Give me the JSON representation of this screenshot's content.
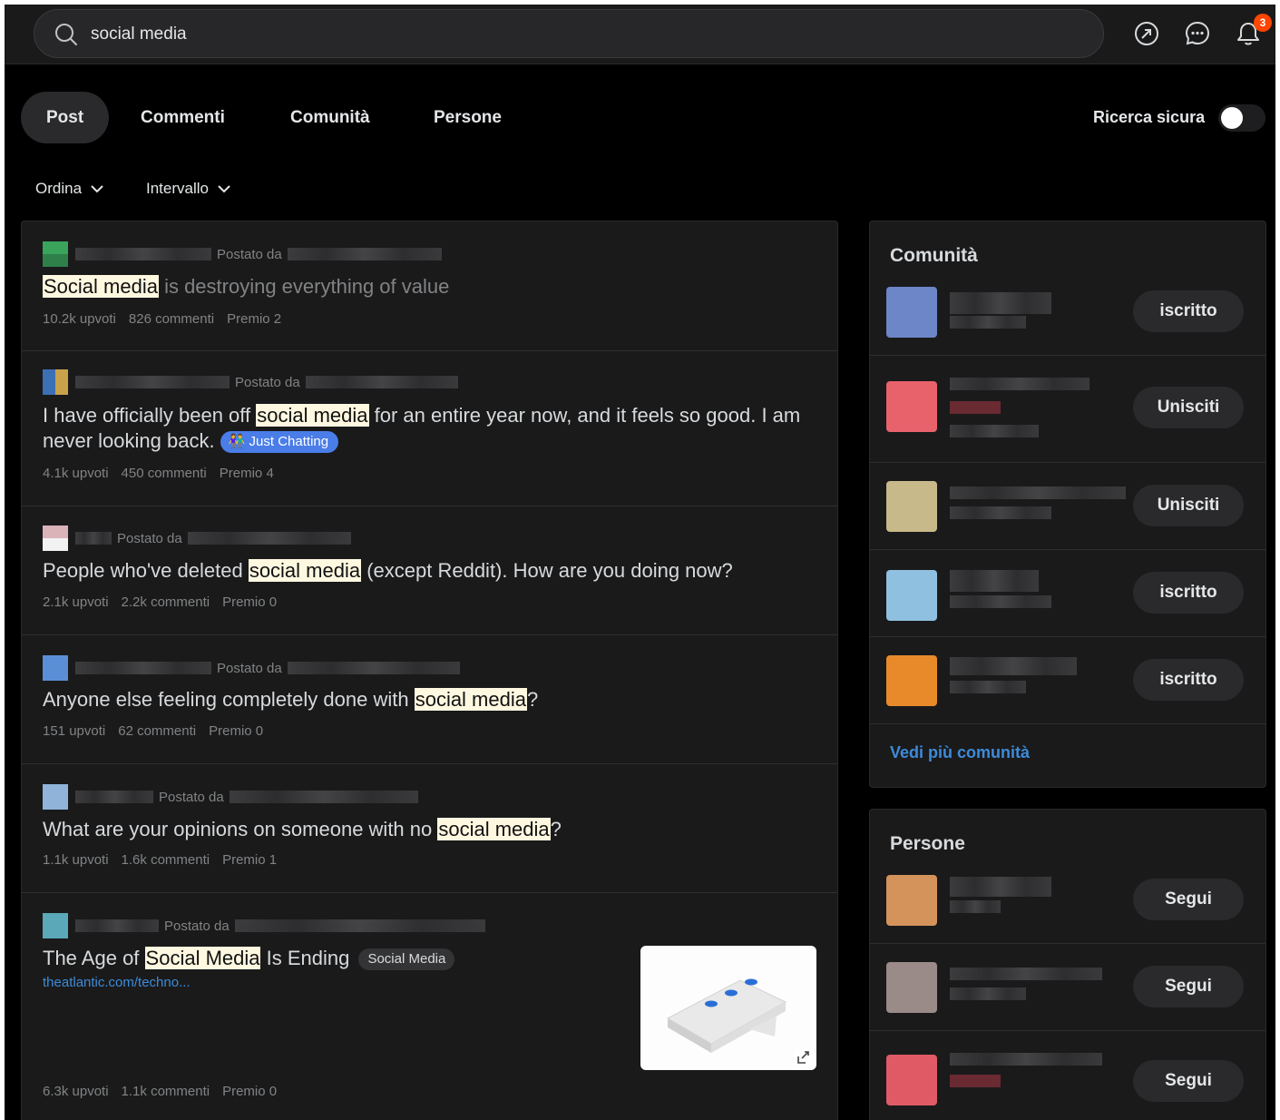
{
  "search": {
    "value": "social media"
  },
  "tabs": [
    {
      "label": "Post",
      "active": true
    },
    {
      "label": "Commenti"
    },
    {
      "label": "Comunità"
    },
    {
      "label": "Persone"
    }
  ],
  "safe_search": {
    "label": "Ricerca sicura",
    "on": false
  },
  "notifications": {
    "count": "3"
  },
  "filters": {
    "sort": "Ordina",
    "range": "Intervallo"
  },
  "posted_by": "Postato da",
  "posts": [
    {
      "title_hl": "Social media",
      "title_rest": " is destroying everything of value",
      "upvotes": "10.2k upvoti",
      "comments": "826 commenti",
      "award": "Premio 2"
    },
    {
      "title_pre": "I have officially been off ",
      "title_hl": "social media",
      "title_post": " for an entire year now, and it feels so good. I am never looking back.",
      "flair": "Just Chatting",
      "upvotes": "4.1k upvoti",
      "comments": "450 commenti",
      "award": "Premio 4"
    },
    {
      "title_pre": "People who've deleted ",
      "title_hl": "social media",
      "title_post": " (except Reddit). How are you doing now?",
      "upvotes": "2.1k upvoti",
      "comments": "2.2k commenti",
      "award": "Premio 0"
    },
    {
      "title_pre": "Anyone else feeling completely done with ",
      "title_hl": "social media",
      "title_post": "?",
      "upvotes": "151 upvoti",
      "comments": "62 commenti",
      "award": "Premio 0"
    },
    {
      "title_pre": "What are your opinions on someone with no ",
      "title_hl": "social media",
      "title_post": "?",
      "upvotes": "1.1k upvoti",
      "comments": "1.6k commenti",
      "award": "Premio 1"
    },
    {
      "title_pre": "The Age of ",
      "title_hl": "Social Media",
      "title_post": " Is Ending",
      "flair": "Social Media",
      "link": "theatlantic.com/techno...",
      "upvotes": "6.3k upvoti",
      "comments": "1.1k commenti",
      "award": "Premio 0"
    }
  ],
  "communities": {
    "title": "Comunità",
    "items": [
      {
        "button": "iscritto",
        "color": "#6d86c8"
      },
      {
        "button": "Unisciti",
        "color": "#e8626c"
      },
      {
        "button": "Unisciti",
        "color": "#c8b98a"
      },
      {
        "button": "iscritto",
        "color": "#8fc0e0"
      },
      {
        "button": "iscritto",
        "color": "#e88a2a"
      }
    ],
    "more": "Vedi più comunità"
  },
  "people": {
    "title": "Persone",
    "items": [
      {
        "button": "Segui",
        "color": "#d4935a"
      },
      {
        "button": "Segui",
        "color": "#9a8a88"
      },
      {
        "button": "Segui",
        "color": "#e05a66"
      }
    ]
  },
  "colors": {
    "accent": "#ff4500",
    "link": "#3d8bd9",
    "flair_blue": "#4a7de8"
  }
}
